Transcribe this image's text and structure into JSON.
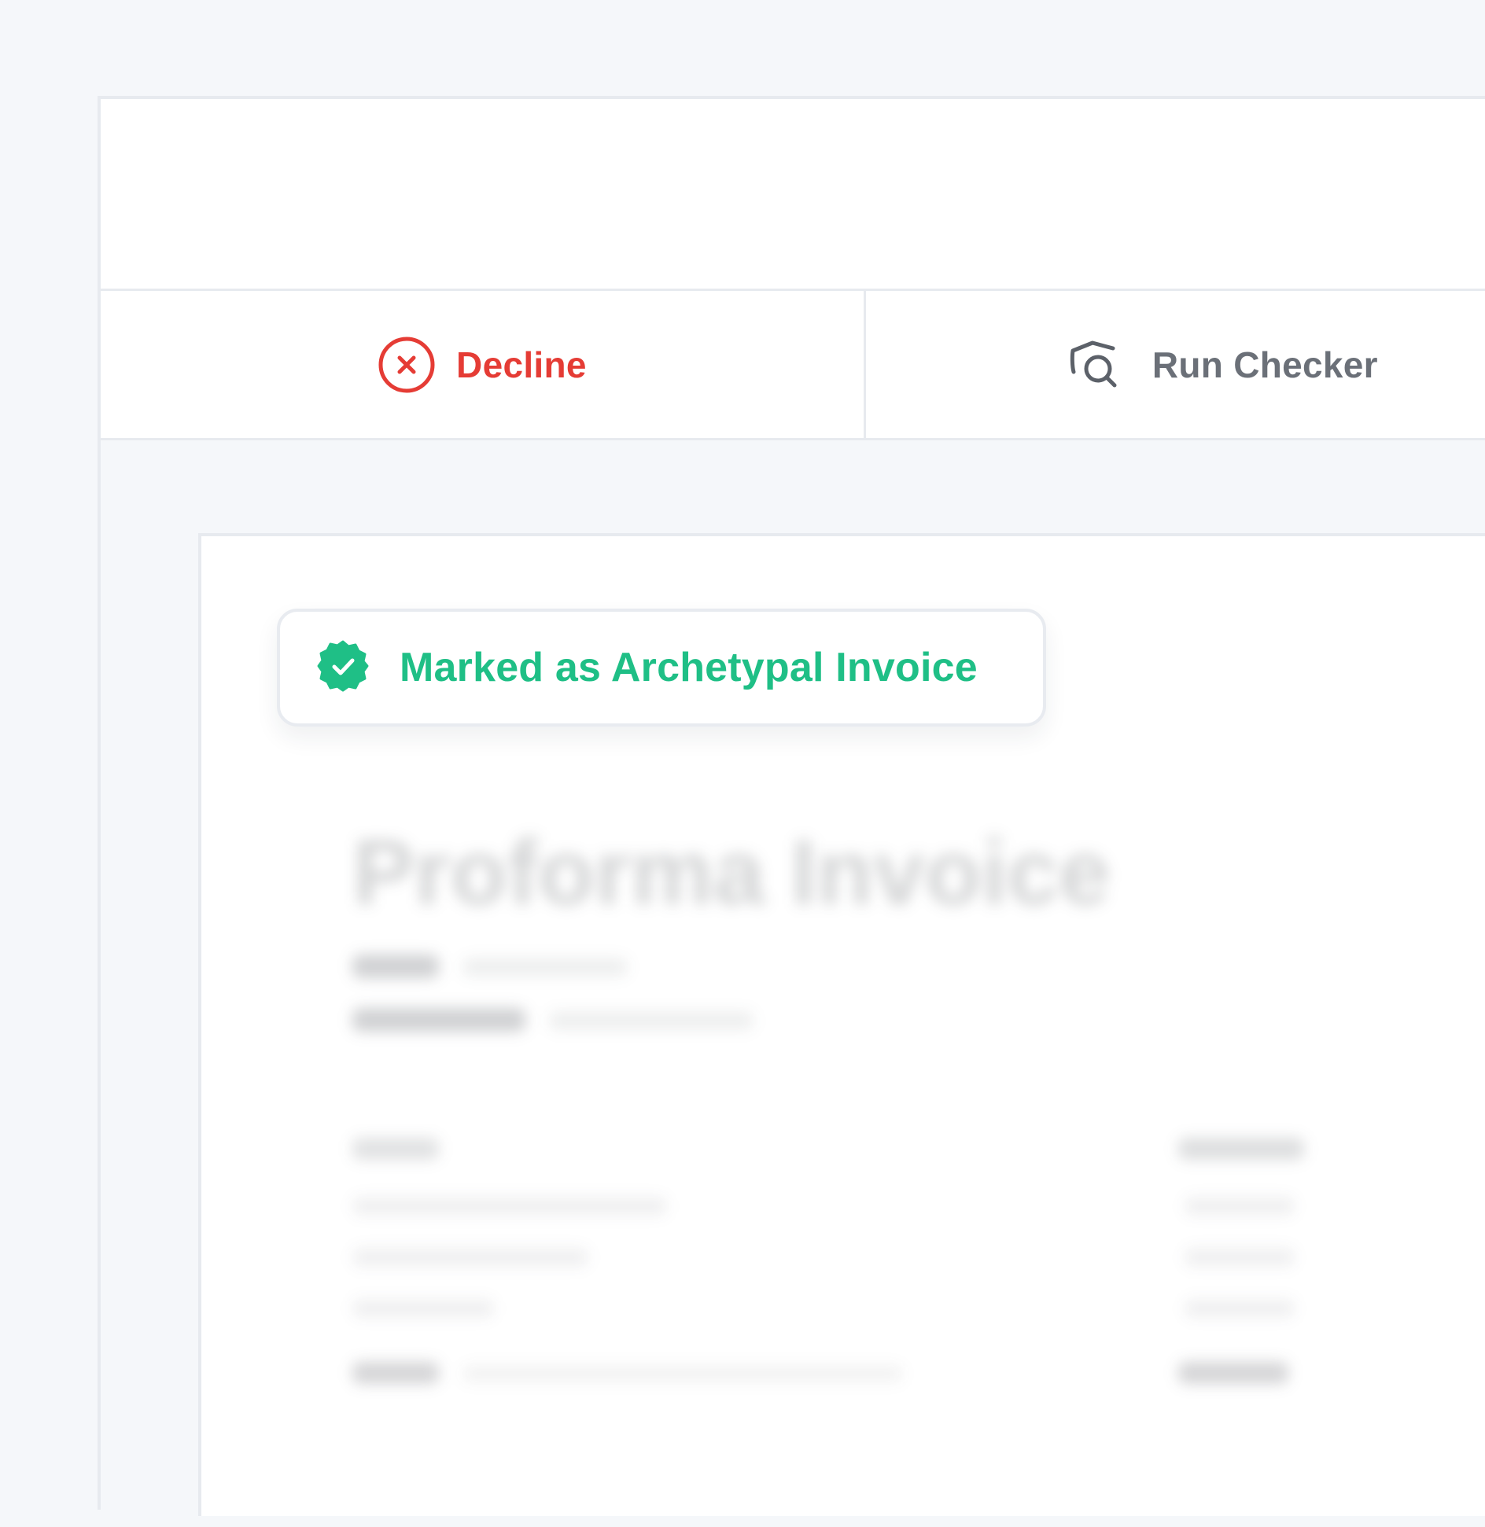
{
  "actions": {
    "decline_label": "Decline",
    "run_checker_label": "Run Checker"
  },
  "badge": {
    "label": "Marked as Archetypal Invoice"
  },
  "document": {
    "title": "Proforma Invoice"
  },
  "colors": {
    "decline": "#e53c35",
    "checker": "#6b7078",
    "success": "#1fbf86",
    "border": "#e7eaef",
    "background": "#f5f7fa"
  },
  "icons": {
    "decline": "close-circle-icon",
    "checker": "shield-search-icon",
    "badge": "verified-badge-icon"
  }
}
